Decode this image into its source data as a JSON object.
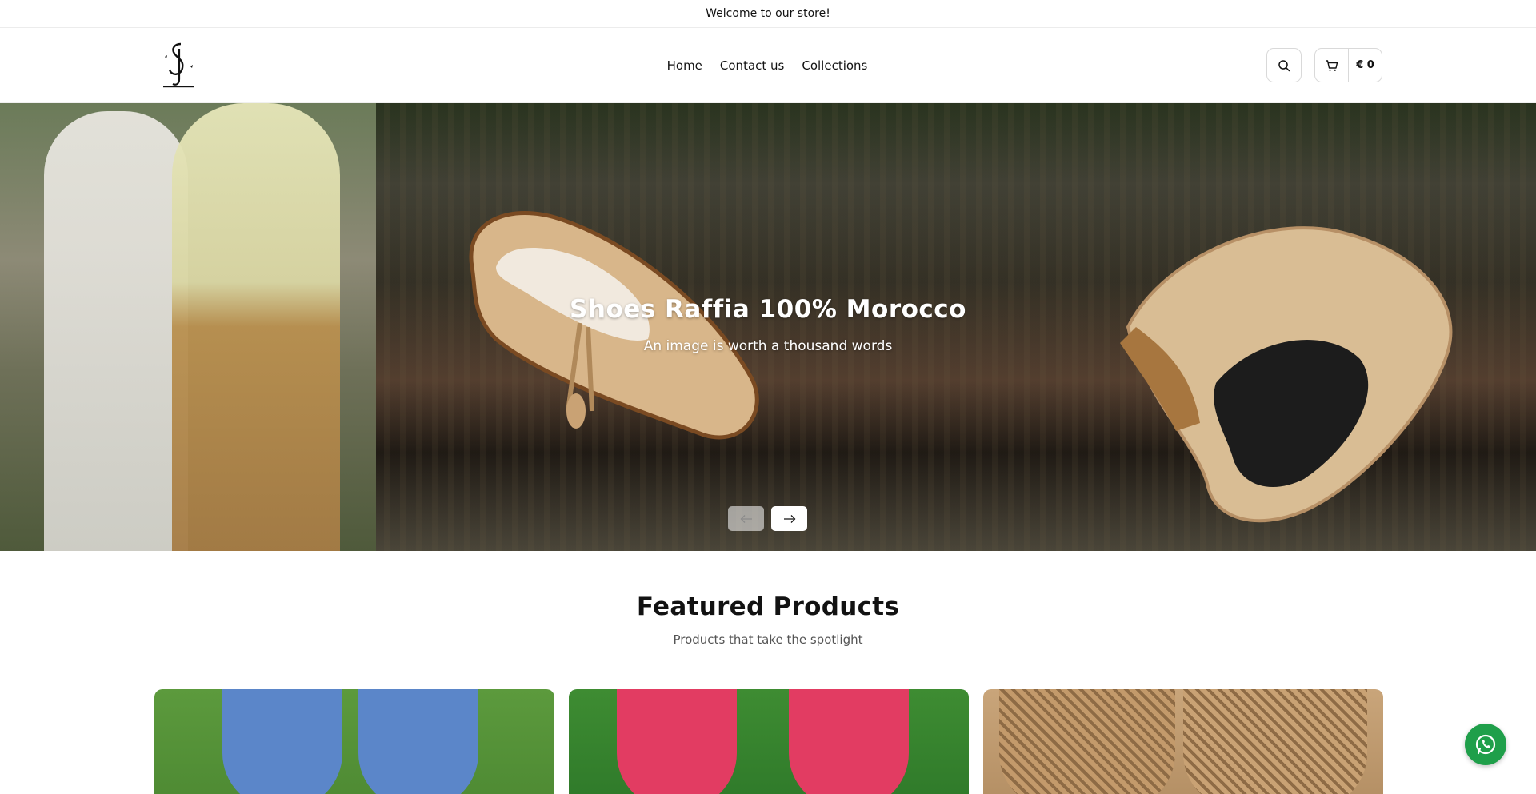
{
  "announcement": {
    "text": "Welcome to our store!"
  },
  "header": {
    "logo": {
      "alt_text": "JRID STYLE",
      "icon": "brand-logo"
    },
    "nav": [
      {
        "label": "Home"
      },
      {
        "label": "Contact us"
      },
      {
        "label": "Collections"
      }
    ],
    "search": {
      "icon": "search-icon"
    },
    "cart": {
      "icon": "cart-icon",
      "total": "€ 0"
    }
  },
  "hero": {
    "title": "Shoes Raffia 100% Morocco",
    "subtitle": "An image is worth a thousand words",
    "prev_icon": "arrow-left-icon",
    "next_icon": "arrow-right-icon"
  },
  "featured": {
    "title": "Featured Products",
    "subtitle": "Products that take the spotlight",
    "products": [
      {
        "color": "#5b86c9"
      },
      {
        "color": "#e23c62"
      },
      {
        "color": "#c9a274"
      }
    ]
  },
  "whatsapp": {
    "icon": "whatsapp-icon",
    "color": "#1f9f4a"
  }
}
